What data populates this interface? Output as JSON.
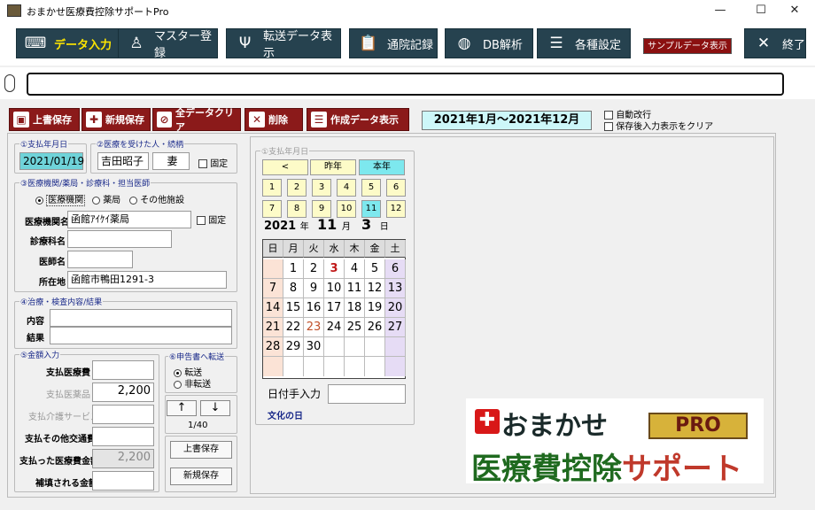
{
  "window": {
    "title": "おまかせ医療費控除サポートPro"
  },
  "toolbar": {
    "buttons": [
      {
        "label": "データ入力"
      },
      {
        "label": "マスター登録"
      },
      {
        "label": "転送データ表示"
      },
      {
        "label": "通院記録"
      },
      {
        "label": "DB解析"
      },
      {
        "label": "各種設定"
      },
      {
        "label": "終了"
      }
    ],
    "sample_badge": "サンプルデータ表示中"
  },
  "actions": {
    "overwrite_save": "上書保存",
    "new_save": "新規保存",
    "clear_all": "全データクリア",
    "delete": "削除",
    "show_created": "作成データ表示"
  },
  "period": "2021年1月～2021年12月",
  "options": {
    "auto_newline": "自動改行",
    "clear_after_save": "保存後入力表示をクリア"
  },
  "form": {
    "pay_date_label": "①支払年月日",
    "pay_date": "2021/01/19",
    "patient_label": "②医療を受けた人・続柄",
    "patient_name": "吉田昭子",
    "relation": "妻",
    "fixed": "固定",
    "facility_group_label": "③医療機関/薬局・診療科・担当医師",
    "facility_types": [
      "医療機関",
      "薬局",
      "その他施設"
    ],
    "facility_name_label": "医療機関名",
    "facility_name": "函館ｱｲｹｲ薬局",
    "dept_label": "診療科名",
    "doctor_label": "医師名",
    "address_label": "所在地",
    "address": "函館市鴨田1291-3",
    "treatment_label": "④治療・検査内容/結果",
    "content_label": "内容",
    "result_label": "結果",
    "amount_label": "⑤金額入力",
    "medical_fee_label": "支払医療費",
    "drug_fee_label": "支払医薬品",
    "drug_fee": "2,200",
    "care_label": "支払介護サービス",
    "transport_label": "支払その他交通費",
    "total_label": "支払った医療費金額",
    "total": "2,200",
    "compensated_label": "補填される金額",
    "transfer_label": "⑥申告書へ転送",
    "transfer": "転送",
    "no_transfer": "非転送",
    "up": "↑",
    "down": "↓",
    "record_pos": "1/40",
    "overwrite_save": "上書保存",
    "new_save": "新規保存"
  },
  "calendar": {
    "group_label": "①支払年月日",
    "prev": "<",
    "last_year": "昨年",
    "this_year": "本年",
    "months": [
      "1",
      "2",
      "3",
      "4",
      "5",
      "6",
      "7",
      "8",
      "9",
      "10",
      "11",
      "12"
    ],
    "selected_month": "11",
    "year": "2021",
    "year_suffix": "年",
    "month": "11",
    "month_suffix": "月",
    "day": "3",
    "day_suffix": "日",
    "weekdays": [
      "日",
      "月",
      "火",
      "水",
      "木",
      "金",
      "土"
    ],
    "weeks": [
      [
        "",
        "1",
        "2",
        "3",
        "4",
        "5",
        "6"
      ],
      [
        "7",
        "8",
        "9",
        "10",
        "11",
        "12",
        "13"
      ],
      [
        "14",
        "15",
        "16",
        "17",
        "18",
        "19",
        "20"
      ],
      [
        "21",
        "22",
        "23",
        "24",
        "25",
        "26",
        "27"
      ],
      [
        "28",
        "29",
        "30",
        "",
        "",
        "",
        ""
      ]
    ],
    "manual_label": "日付手入力",
    "holiday": "文化の日"
  },
  "logo": {
    "line1": "おまかせ",
    "badge": "PRO",
    "line2a": "医療費控除",
    "line2b": "サポート"
  }
}
